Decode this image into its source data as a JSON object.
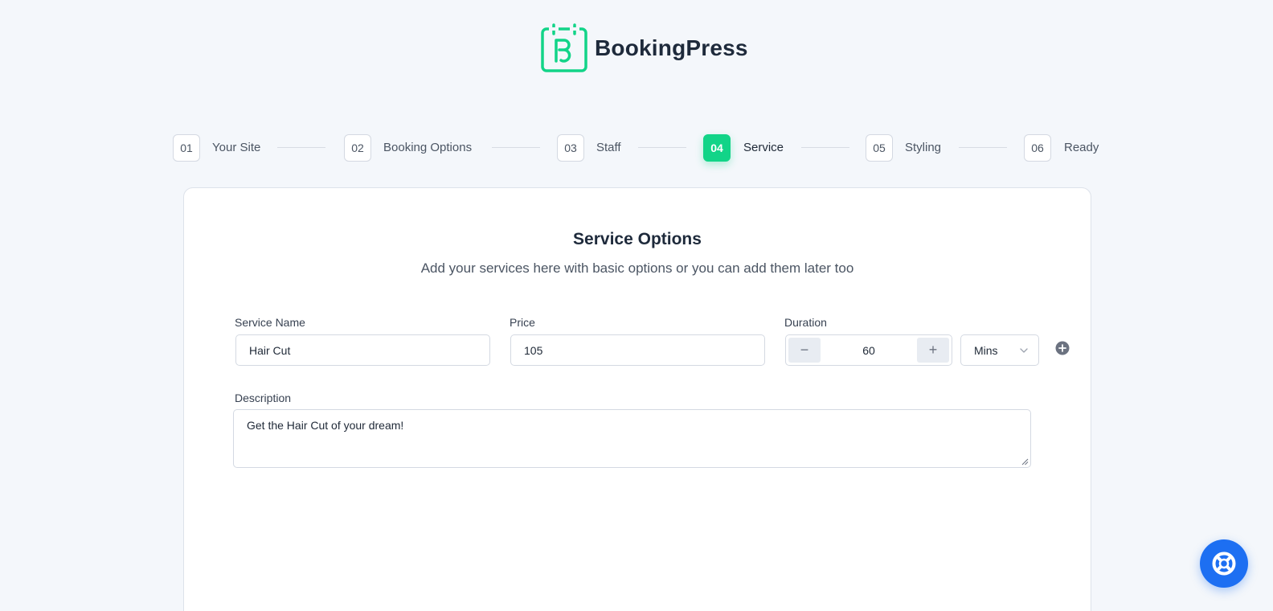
{
  "brand": {
    "name": "BookingPress",
    "accent": "#12d488",
    "help_color": "#1d6ff2"
  },
  "steps": [
    {
      "num": "01",
      "label": "Your Site",
      "active": false
    },
    {
      "num": "02",
      "label": "Booking Options",
      "active": false
    },
    {
      "num": "03",
      "label": "Staff",
      "active": false
    },
    {
      "num": "04",
      "label": "Service",
      "active": true
    },
    {
      "num": "05",
      "label": "Styling",
      "active": false
    },
    {
      "num": "06",
      "label": "Ready",
      "active": false
    }
  ],
  "card": {
    "title": "Service Options",
    "subtitle": "Add your services here with basic options or you can add them later too"
  },
  "form": {
    "service_name_label": "Service Name",
    "service_name_value": "Hair Cut",
    "price_label": "Price",
    "price_value": "105",
    "duration_label": "Duration",
    "duration_value": "60",
    "duration_minus": "−",
    "duration_plus": "+",
    "duration_unit": "Mins",
    "description_label": "Description",
    "description_value": "Get the Hair Cut of your dream!"
  },
  "icons": {
    "logo": "bookingpress-logo-icon",
    "add": "plus-circle-icon",
    "unit_dropdown": "chevron-down-icon",
    "help": "lifebuoy-icon"
  }
}
